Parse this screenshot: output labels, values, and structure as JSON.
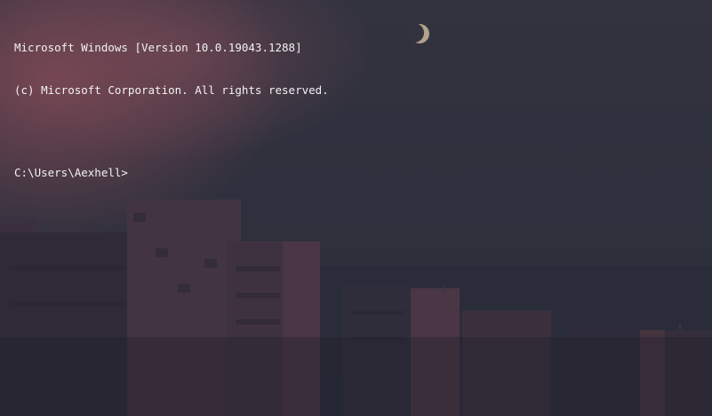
{
  "terminal": {
    "banner_line_1": "Microsoft Windows [Version 10.0.19043.1288]",
    "banner_line_2": "(c) Microsoft Corporation. All rights reserved.",
    "prompt": "C:\\Users\\Aexhell>",
    "input_value": ""
  },
  "background": {
    "description_icon": "moon-icon",
    "colors": {
      "sky": "#2f303d",
      "cloud_glow": "#804a56",
      "buildings_dark": "#262634",
      "buildings_lit": "#5a3a48",
      "moon": "#c9b69a",
      "text": "#f2f2f2"
    }
  }
}
